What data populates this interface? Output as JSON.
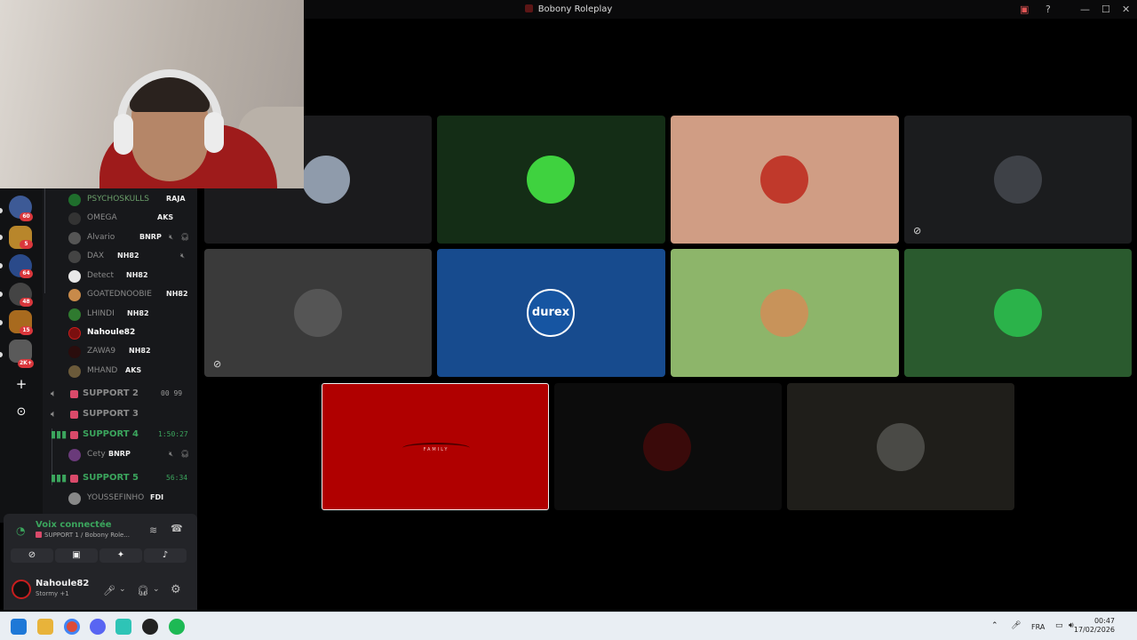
{
  "window": {
    "title": "Bobony Roleplay"
  },
  "servers": [
    {
      "badge": "60",
      "color": "#3d5a96"
    },
    {
      "badge": "5",
      "color": "#b8862b"
    },
    {
      "badge": "64",
      "color": "#2a4a8a"
    },
    {
      "badge": "48",
      "color": "#444444"
    },
    {
      "badge": "15",
      "color": "#a86a1e"
    },
    {
      "badge": "2K+",
      "color": "#5a5a5a"
    }
  ],
  "members": [
    {
      "name": "PSYCHOSKULLS",
      "tag": "RAJA",
      "color": "#6b9f6a",
      "av": "#1f6e2c"
    },
    {
      "name": "OMEGA",
      "tag": "AKS",
      "color": "#6b9f6a",
      "av": "#333333"
    },
    {
      "name": "Alvario",
      "tag": "BNRP",
      "color": "#8a8a8a",
      "av": "#555555"
    },
    {
      "name": "DAX",
      "tag": "NH82",
      "color": "#8a8a8a",
      "av": "#444444"
    },
    {
      "name": "Detect",
      "tag": "NH82",
      "color": "#8a8a8a",
      "av": "#e8e8e8"
    },
    {
      "name": "GOATEDNOOBIE",
      "tag": "NH82",
      "color": "#8a8a8a",
      "av": "#c88a4a"
    },
    {
      "name": "LHINDI",
      "tag": "NH82",
      "color": "#8a8a8a",
      "av": "#2f7a2f"
    },
    {
      "name": "Nahoule82",
      "tag": "",
      "color": "#ffffff",
      "av": "#7a0f0f"
    },
    {
      "name": "ZAWA9",
      "tag": "NH82",
      "color": "#8a8a8a",
      "av": "#2a0d0d"
    },
    {
      "name": "MHAND",
      "tag": "AKS",
      "color": "#8a8a8a",
      "av": "#6b5a3a"
    }
  ],
  "voice_channels": [
    {
      "name": "SUPPORT 2",
      "time": "00 99",
      "active": false
    },
    {
      "name": "SUPPORT 3",
      "time": "",
      "active": false
    },
    {
      "name": "SUPPORT 4",
      "time": "1:50:27",
      "active": true
    },
    {
      "name": "SUPPORT 5",
      "time": "56:34",
      "active": true
    }
  ],
  "sub_members": [
    {
      "name": "Cety",
      "tag": "BNRP",
      "av": "#6a3a7a"
    },
    {
      "name": "YOUSSEFINHO",
      "tag": "FDI",
      "av": "#888888"
    }
  ],
  "voice_panel": {
    "status": "Voix connectée",
    "channel": "SUPPORT 1 / Bobony Role..."
  },
  "user": {
    "name": "Nahoule82",
    "status": "Stormy +1"
  },
  "tiles": [
    {
      "bg": "#1b1b1d",
      "av": "#8f9bab",
      "muted": false,
      "deaf": false
    },
    {
      "bg": "#142d16",
      "av": "#3fd23f",
      "muted": false,
      "deaf": false
    },
    {
      "bg": "#d09d84",
      "av": "#c0392b",
      "muted": false,
      "deaf": false
    },
    {
      "bg": "#1b1c1e",
      "av": "#3e4147",
      "muted": false,
      "deaf": true
    },
    {
      "bg": "#3a3a3a",
      "av": "#555555",
      "muted": true,
      "deaf": false
    },
    {
      "bg": "#174b8e",
      "av": "#1655a2",
      "muted": false,
      "deaf": false,
      "label": "durex"
    },
    {
      "bg": "#8db56a",
      "av": "#c8935a",
      "muted": false,
      "deaf": false
    },
    {
      "bg": "#2a5a2e",
      "av": "#2bb34a",
      "muted": false,
      "deaf": false
    },
    {
      "bg": "#b00000",
      "av": "#8a0000",
      "muted": false,
      "deaf": false,
      "label": "FAMILY",
      "speaking": true
    },
    {
      "bg": "#0c0c0c",
      "av": "#3a0a0a",
      "muted": false,
      "deaf": false
    },
    {
      "bg": "#1f1e1a",
      "av": "#4a4a46",
      "muted": false,
      "deaf": false
    }
  ],
  "taskbar": {
    "lang": "FRA",
    "time": "00:47",
    "date": "17/02/2026"
  }
}
